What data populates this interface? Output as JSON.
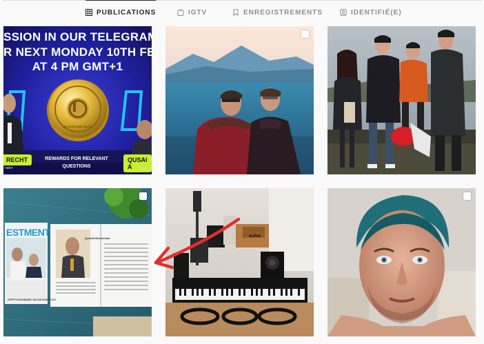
{
  "tabs": [
    {
      "id": "publications",
      "label": "PUBLICATIONS",
      "icon": "grid-icon",
      "active": true
    },
    {
      "id": "igtv",
      "label": "IGTV",
      "icon": "igtv-icon",
      "active": false
    },
    {
      "id": "enregistrements",
      "label": "ENREGISTREMENTS",
      "icon": "bookmark-icon",
      "active": false
    },
    {
      "id": "identifie",
      "label": "IDENTIFIÉ(E)",
      "icon": "tagged-icon",
      "active": false
    }
  ],
  "posts": {
    "p1": {
      "line1": "SSION IN OUR TELEGRAM G",
      "line2": "R NEXT MONDAY 10TH FEB",
      "line3": "AT 4 PM GMT+1",
      "name_left": "RECHT",
      "name_right": "QUSAI A",
      "reward_line1": "REWARDS FOR RELEVANT",
      "reward_line2": "QUESTIONS",
      "role_left": "nator",
      "role_right": "Chief I",
      "coin_text": "BLOCKCHAIN TALKS"
    },
    "p4": {
      "mag_title": "ESTMENT",
      "mag_heading": "Quotidi Blockchain",
      "mag_footer": "CRYPTO-MONNAIES / BLOCKCHAIN / ICO"
    },
    "p5": {
      "label": "ALPHA"
    }
  },
  "colors": {
    "active_tab": "#262626",
    "inactive_tab": "#8e8e8e",
    "arrow": "#e0302a",
    "name_badge": "#c6f030"
  }
}
